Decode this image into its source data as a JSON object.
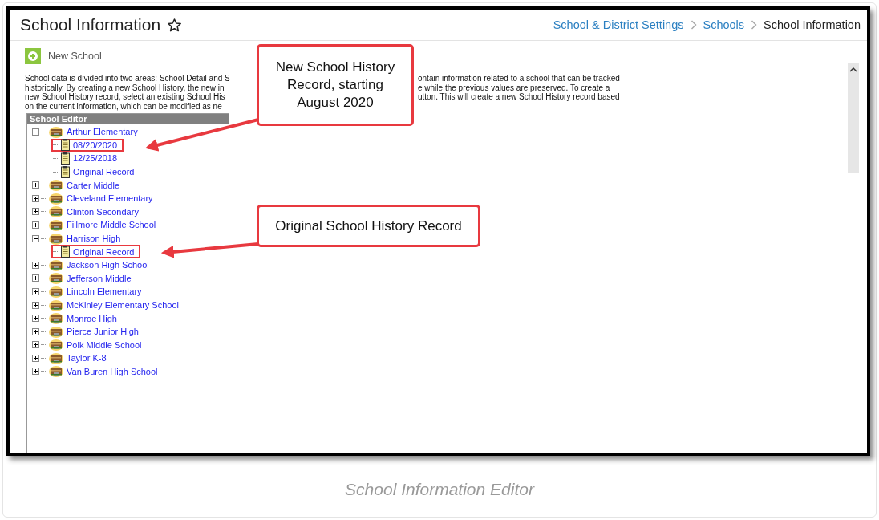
{
  "page": {
    "title": "School Information",
    "favorite": false,
    "breadcrumb": [
      {
        "label": "School & District Settings",
        "current": false
      },
      {
        "label": "Schools",
        "current": false
      },
      {
        "label": "School Information",
        "current": true
      }
    ]
  },
  "toolbar": {
    "new_button": "New School"
  },
  "description_lines": [
    {
      "left": "School data is divided into two areas: School Detail and S",
      "right": "ontain information related to a school that can be tracked"
    },
    {
      "left": "historically. By creating a new School History, the new in",
      "right": "e while the previous values are preserved. To create a"
    },
    {
      "left": "new School History record, select an existing School His",
      "right": "utton. This will create a new School History record based"
    },
    {
      "left": "on the current information, which can be modified as ne"
    }
  ],
  "school_editor": {
    "title": "School Editor",
    "schools": [
      {
        "name": "Arthur Elementary",
        "expanded": true,
        "children": [
          {
            "label": "08/20/2020",
            "highlighted": true
          },
          {
            "label": "12/25/2018",
            "highlighted": false
          },
          {
            "label": "Original Record",
            "highlighted": false
          }
        ]
      },
      {
        "name": "Carter Middle",
        "expanded": false
      },
      {
        "name": "Cleveland Elementary",
        "expanded": false
      },
      {
        "name": "Clinton Secondary",
        "expanded": false
      },
      {
        "name": "Fillmore Middle School",
        "expanded": false
      },
      {
        "name": "Harrison High",
        "expanded": true,
        "children": [
          {
            "label": "Original Record",
            "highlighted": true
          }
        ]
      },
      {
        "name": "Jackson High School",
        "expanded": false
      },
      {
        "name": "Jefferson Middle",
        "expanded": false
      },
      {
        "name": "Lincoln Elementary",
        "expanded": false
      },
      {
        "name": "McKinley Elementary School",
        "expanded": false
      },
      {
        "name": "Monroe High",
        "expanded": false
      },
      {
        "name": "Pierce Junior High",
        "expanded": false
      },
      {
        "name": "Polk Middle School",
        "expanded": false
      },
      {
        "name": "Taylor K-8",
        "expanded": false
      },
      {
        "name": "Van Buren High School",
        "expanded": false
      }
    ]
  },
  "callouts": [
    {
      "text": "New School History Record, starting August 2020",
      "kind": "tall"
    },
    {
      "text": "Original School History Record",
      "kind": "wide"
    }
  ],
  "caption": "School Information Editor"
}
